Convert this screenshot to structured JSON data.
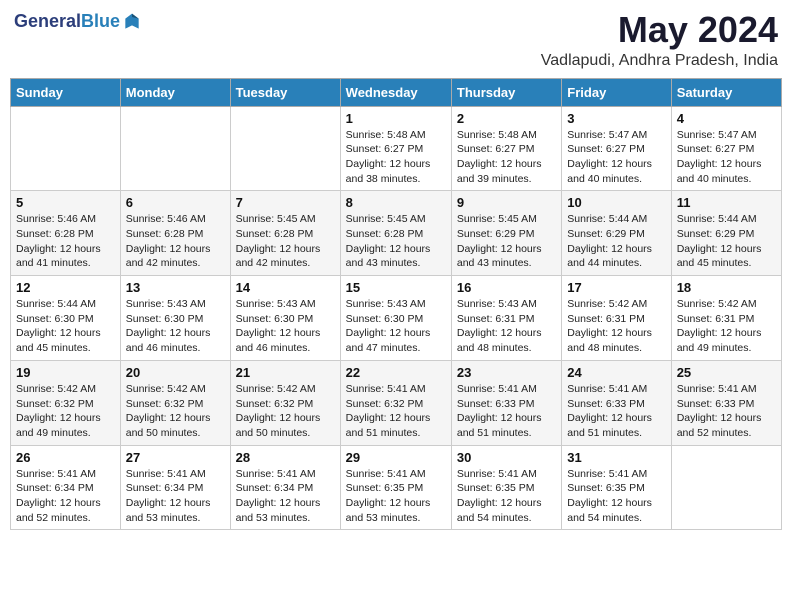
{
  "header": {
    "logo": {
      "general": "General",
      "blue": "Blue"
    },
    "title": "May 2024",
    "subtitle": "Vadlapudi, Andhra Pradesh, India"
  },
  "calendar": {
    "days_of_week": [
      "Sunday",
      "Monday",
      "Tuesday",
      "Wednesday",
      "Thursday",
      "Friday",
      "Saturday"
    ],
    "rows": [
      [
        {
          "day": "",
          "sunrise": "",
          "sunset": "",
          "daylight": ""
        },
        {
          "day": "",
          "sunrise": "",
          "sunset": "",
          "daylight": ""
        },
        {
          "day": "",
          "sunrise": "",
          "sunset": "",
          "daylight": ""
        },
        {
          "day": "1",
          "sunrise": "Sunrise: 5:48 AM",
          "sunset": "Sunset: 6:27 PM",
          "daylight": "Daylight: 12 hours and 38 minutes."
        },
        {
          "day": "2",
          "sunrise": "Sunrise: 5:48 AM",
          "sunset": "Sunset: 6:27 PM",
          "daylight": "Daylight: 12 hours and 39 minutes."
        },
        {
          "day": "3",
          "sunrise": "Sunrise: 5:47 AM",
          "sunset": "Sunset: 6:27 PM",
          "daylight": "Daylight: 12 hours and 40 minutes."
        },
        {
          "day": "4",
          "sunrise": "Sunrise: 5:47 AM",
          "sunset": "Sunset: 6:27 PM",
          "daylight": "Daylight: 12 hours and 40 minutes."
        }
      ],
      [
        {
          "day": "5",
          "sunrise": "Sunrise: 5:46 AM",
          "sunset": "Sunset: 6:28 PM",
          "daylight": "Daylight: 12 hours and 41 minutes."
        },
        {
          "day": "6",
          "sunrise": "Sunrise: 5:46 AM",
          "sunset": "Sunset: 6:28 PM",
          "daylight": "Daylight: 12 hours and 42 minutes."
        },
        {
          "day": "7",
          "sunrise": "Sunrise: 5:45 AM",
          "sunset": "Sunset: 6:28 PM",
          "daylight": "Daylight: 12 hours and 42 minutes."
        },
        {
          "day": "8",
          "sunrise": "Sunrise: 5:45 AM",
          "sunset": "Sunset: 6:28 PM",
          "daylight": "Daylight: 12 hours and 43 minutes."
        },
        {
          "day": "9",
          "sunrise": "Sunrise: 5:45 AM",
          "sunset": "Sunset: 6:29 PM",
          "daylight": "Daylight: 12 hours and 43 minutes."
        },
        {
          "day": "10",
          "sunrise": "Sunrise: 5:44 AM",
          "sunset": "Sunset: 6:29 PM",
          "daylight": "Daylight: 12 hours and 44 minutes."
        },
        {
          "day": "11",
          "sunrise": "Sunrise: 5:44 AM",
          "sunset": "Sunset: 6:29 PM",
          "daylight": "Daylight: 12 hours and 45 minutes."
        }
      ],
      [
        {
          "day": "12",
          "sunrise": "Sunrise: 5:44 AM",
          "sunset": "Sunset: 6:30 PM",
          "daylight": "Daylight: 12 hours and 45 minutes."
        },
        {
          "day": "13",
          "sunrise": "Sunrise: 5:43 AM",
          "sunset": "Sunset: 6:30 PM",
          "daylight": "Daylight: 12 hours and 46 minutes."
        },
        {
          "day": "14",
          "sunrise": "Sunrise: 5:43 AM",
          "sunset": "Sunset: 6:30 PM",
          "daylight": "Daylight: 12 hours and 46 minutes."
        },
        {
          "day": "15",
          "sunrise": "Sunrise: 5:43 AM",
          "sunset": "Sunset: 6:30 PM",
          "daylight": "Daylight: 12 hours and 47 minutes."
        },
        {
          "day": "16",
          "sunrise": "Sunrise: 5:43 AM",
          "sunset": "Sunset: 6:31 PM",
          "daylight": "Daylight: 12 hours and 48 minutes."
        },
        {
          "day": "17",
          "sunrise": "Sunrise: 5:42 AM",
          "sunset": "Sunset: 6:31 PM",
          "daylight": "Daylight: 12 hours and 48 minutes."
        },
        {
          "day": "18",
          "sunrise": "Sunrise: 5:42 AM",
          "sunset": "Sunset: 6:31 PM",
          "daylight": "Daylight: 12 hours and 49 minutes."
        }
      ],
      [
        {
          "day": "19",
          "sunrise": "Sunrise: 5:42 AM",
          "sunset": "Sunset: 6:32 PM",
          "daylight": "Daylight: 12 hours and 49 minutes."
        },
        {
          "day": "20",
          "sunrise": "Sunrise: 5:42 AM",
          "sunset": "Sunset: 6:32 PM",
          "daylight": "Daylight: 12 hours and 50 minutes."
        },
        {
          "day": "21",
          "sunrise": "Sunrise: 5:42 AM",
          "sunset": "Sunset: 6:32 PM",
          "daylight": "Daylight: 12 hours and 50 minutes."
        },
        {
          "day": "22",
          "sunrise": "Sunrise: 5:41 AM",
          "sunset": "Sunset: 6:32 PM",
          "daylight": "Daylight: 12 hours and 51 minutes."
        },
        {
          "day": "23",
          "sunrise": "Sunrise: 5:41 AM",
          "sunset": "Sunset: 6:33 PM",
          "daylight": "Daylight: 12 hours and 51 minutes."
        },
        {
          "day": "24",
          "sunrise": "Sunrise: 5:41 AM",
          "sunset": "Sunset: 6:33 PM",
          "daylight": "Daylight: 12 hours and 51 minutes."
        },
        {
          "day": "25",
          "sunrise": "Sunrise: 5:41 AM",
          "sunset": "Sunset: 6:33 PM",
          "daylight": "Daylight: 12 hours and 52 minutes."
        }
      ],
      [
        {
          "day": "26",
          "sunrise": "Sunrise: 5:41 AM",
          "sunset": "Sunset: 6:34 PM",
          "daylight": "Daylight: 12 hours and 52 minutes."
        },
        {
          "day": "27",
          "sunrise": "Sunrise: 5:41 AM",
          "sunset": "Sunset: 6:34 PM",
          "daylight": "Daylight: 12 hours and 53 minutes."
        },
        {
          "day": "28",
          "sunrise": "Sunrise: 5:41 AM",
          "sunset": "Sunset: 6:34 PM",
          "daylight": "Daylight: 12 hours and 53 minutes."
        },
        {
          "day": "29",
          "sunrise": "Sunrise: 5:41 AM",
          "sunset": "Sunset: 6:35 PM",
          "daylight": "Daylight: 12 hours and 53 minutes."
        },
        {
          "day": "30",
          "sunrise": "Sunrise: 5:41 AM",
          "sunset": "Sunset: 6:35 PM",
          "daylight": "Daylight: 12 hours and 54 minutes."
        },
        {
          "day": "31",
          "sunrise": "Sunrise: 5:41 AM",
          "sunset": "Sunset: 6:35 PM",
          "daylight": "Daylight: 12 hours and 54 minutes."
        },
        {
          "day": "",
          "sunrise": "",
          "sunset": "",
          "daylight": ""
        }
      ]
    ]
  }
}
